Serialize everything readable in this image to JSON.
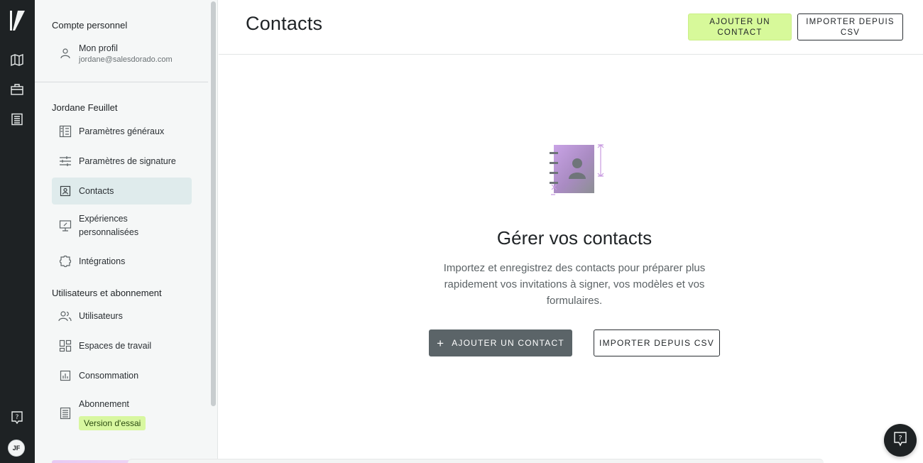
{
  "rail": {
    "avatar_initials": "JF",
    "icons": [
      "logo-icon",
      "map-icon",
      "briefcase-icon",
      "document-list-icon",
      "help-icon"
    ]
  },
  "sidebar": {
    "personal_section": "Compte personnel",
    "profile": {
      "label": "Mon profil",
      "email": "jordane@salesdorado.com"
    },
    "org_section": "Jordane Feuillet",
    "org_items": [
      {
        "label": "Paramètres généraux",
        "icon": "building-settings-icon"
      },
      {
        "label": "Paramètres de signature",
        "icon": "sliders-icon"
      },
      {
        "label": "Contacts",
        "icon": "contact-card-icon",
        "active": true
      },
      {
        "label": "Expériences personnalisées",
        "icon": "monitor-pen-icon"
      },
      {
        "label": "Intégrations",
        "icon": "puzzle-icon"
      }
    ],
    "users_section": "Utilisateurs et abonnement",
    "users_items": [
      {
        "label": "Utilisateurs",
        "icon": "users-icon"
      },
      {
        "label": "Espaces de travail",
        "icon": "workspace-grid-icon"
      },
      {
        "label": "Consommation",
        "icon": "bar-chart-icon"
      },
      {
        "label": "Abonnement",
        "icon": "receipt-icon"
      }
    ],
    "trial_badge": "Version d'essai"
  },
  "header": {
    "title": "Contacts",
    "add_contact_button": "AJOUTER UN CONTACT",
    "import_csv_button": "IMPORTER DEPUIS CSV"
  },
  "empty_state": {
    "title": "Gérer vos contacts",
    "description": "Importez et enregistrez des contacts pour préparer plus rapidement vos invitations à signer, vos modèles et vos formulaires.",
    "add_button": "AJOUTER UN CONTACT",
    "import_button": "IMPORTER DEPUIS CSV"
  },
  "colors": {
    "rail_bg": "#1e2224",
    "sidebar_bg": "#f5f7f7",
    "active_item_bg": "#dfebec",
    "lime_accent": "#d7f99a",
    "dark_button": "#5b6468",
    "illustration_purple": "#c89ae0"
  }
}
